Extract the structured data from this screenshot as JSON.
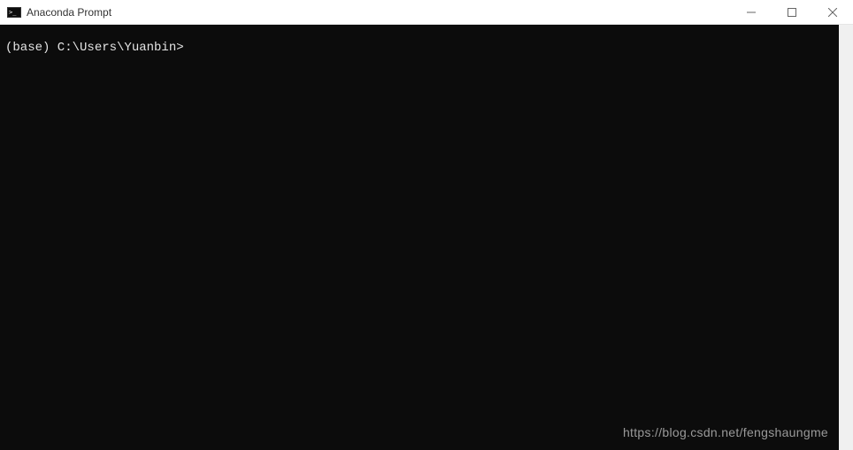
{
  "window": {
    "title": "Anaconda Prompt"
  },
  "terminal": {
    "prompt": "(base) C:\\Users\\Yuanbin>"
  },
  "watermark": {
    "text": "https://blog.csdn.net/fengshaungme"
  }
}
